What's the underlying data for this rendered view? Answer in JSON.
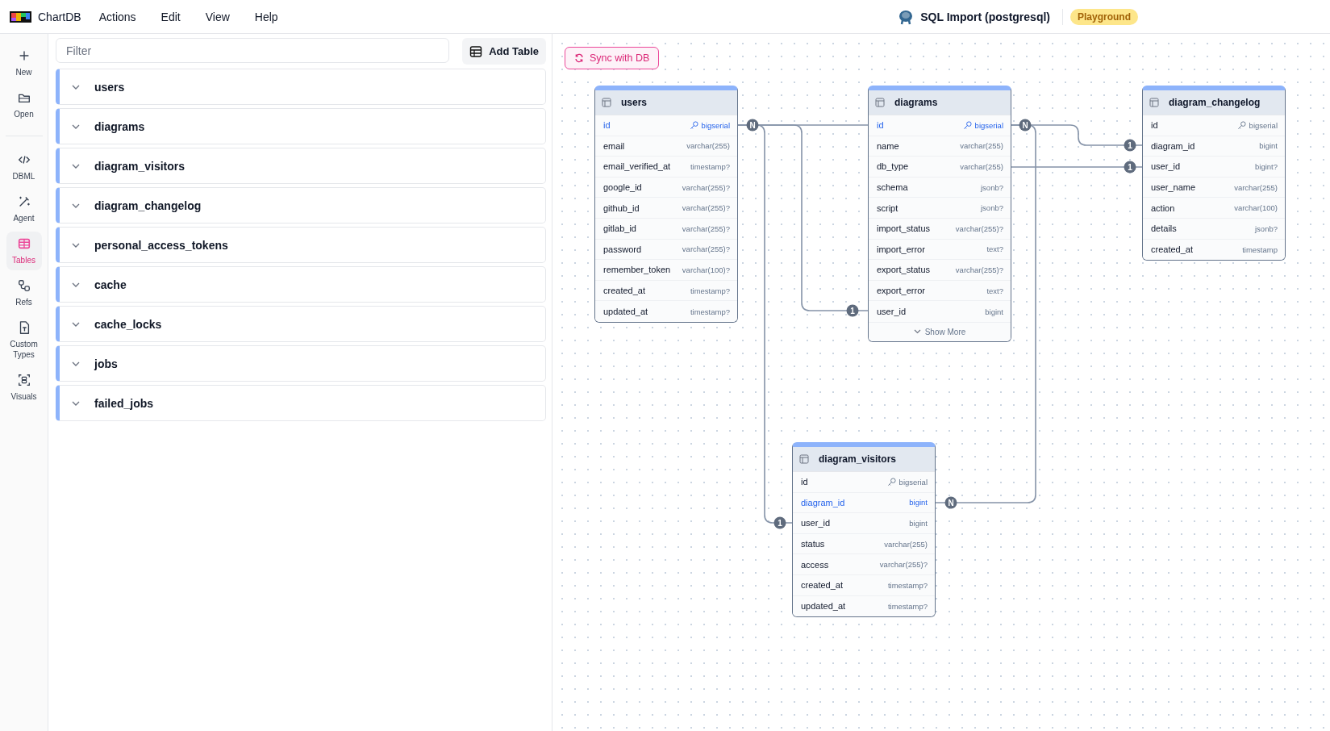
{
  "header": {
    "app_name": "ChartDB",
    "menus": [
      "Actions",
      "Edit",
      "View",
      "Help"
    ],
    "diagram_title": "SQL Import (postgresql)",
    "badge": "Playground"
  },
  "rail": {
    "items": [
      {
        "kind": "new",
        "label": "New",
        "selected": false
      },
      {
        "kind": "open",
        "label": "Open",
        "selected": false
      },
      {
        "kind": "dbml",
        "label": "DBML",
        "selected": false
      },
      {
        "kind": "agent",
        "label": "Agent",
        "selected": false
      },
      {
        "kind": "tables",
        "label": "Tables",
        "selected": true
      },
      {
        "kind": "refs",
        "label": "Refs",
        "selected": false
      },
      {
        "kind": "types",
        "label": "Custom Types",
        "selected": false
      },
      {
        "kind": "visuals",
        "label": "Visuals",
        "selected": false
      }
    ]
  },
  "table_list": {
    "filter": {
      "placeholder": "Filter"
    },
    "add_button": "Add Table",
    "items": [
      {
        "name": "users",
        "expanded": false
      },
      {
        "name": "diagrams",
        "expanded": false
      },
      {
        "name": "diagram_visitors",
        "expanded": false
      },
      {
        "name": "diagram_changelog",
        "expanded": false
      },
      {
        "name": "personal_access_tokens",
        "expanded": false
      },
      {
        "name": "cache",
        "expanded": false
      },
      {
        "name": "cache_locks",
        "expanded": false
      },
      {
        "name": "jobs",
        "expanded": false
      },
      {
        "name": "failed_jobs",
        "expanded": false
      }
    ]
  },
  "canvas": {
    "sync_button": "Sync with DB",
    "tables": [
      {
        "name": "users",
        "fields": [
          {
            "name": "id",
            "type": "bigserial",
            "primary_key": true,
            "highlighted": true
          },
          {
            "name": "email",
            "type": "varchar(255)",
            "primary_key": false,
            "highlighted": false
          },
          {
            "name": "email_verified_at",
            "type": "timestamp?",
            "primary_key": false,
            "highlighted": false
          },
          {
            "name": "google_id",
            "type": "varchar(255)?",
            "primary_key": false,
            "highlighted": false
          },
          {
            "name": "github_id",
            "type": "varchar(255)?",
            "primary_key": false,
            "highlighted": false
          },
          {
            "name": "gitlab_id",
            "type": "varchar(255)?",
            "primary_key": false,
            "highlighted": false
          },
          {
            "name": "password",
            "type": "varchar(255)?",
            "primary_key": false,
            "highlighted": false
          },
          {
            "name": "remember_token",
            "type": "varchar(100)?",
            "primary_key": false,
            "highlighted": false
          },
          {
            "name": "created_at",
            "type": "timestamp?",
            "primary_key": false,
            "highlighted": false
          },
          {
            "name": "updated_at",
            "type": "timestamp?",
            "primary_key": false,
            "highlighted": false
          }
        ]
      },
      {
        "name": "diagrams",
        "show_more": "Show More",
        "fields": [
          {
            "name": "id",
            "type": "bigserial",
            "primary_key": true,
            "highlighted": true
          },
          {
            "name": "name",
            "type": "varchar(255)",
            "primary_key": false,
            "highlighted": false
          },
          {
            "name": "db_type",
            "type": "varchar(255)",
            "primary_key": false,
            "highlighted": false
          },
          {
            "name": "schema",
            "type": "jsonb?",
            "primary_key": false,
            "highlighted": false
          },
          {
            "name": "script",
            "type": "jsonb?",
            "primary_key": false,
            "highlighted": false
          },
          {
            "name": "import_status",
            "type": "varchar(255)?",
            "primary_key": false,
            "highlighted": false
          },
          {
            "name": "import_error",
            "type": "text?",
            "primary_key": false,
            "highlighted": false
          },
          {
            "name": "export_status",
            "type": "varchar(255)?",
            "primary_key": false,
            "highlighted": false
          },
          {
            "name": "export_error",
            "type": "text?",
            "primary_key": false,
            "highlighted": false
          },
          {
            "name": "user_id",
            "type": "bigint",
            "primary_key": false,
            "highlighted": false
          }
        ]
      },
      {
        "name": "diagram_changelog",
        "fields": [
          {
            "name": "id",
            "type": "bigserial",
            "primary_key": true,
            "highlighted": false
          },
          {
            "name": "diagram_id",
            "type": "bigint",
            "primary_key": false,
            "highlighted": false
          },
          {
            "name": "user_id",
            "type": "bigint?",
            "primary_key": false,
            "highlighted": false
          },
          {
            "name": "user_name",
            "type": "varchar(255)",
            "primary_key": false,
            "highlighted": false
          },
          {
            "name": "action",
            "type": "varchar(100)",
            "primary_key": false,
            "highlighted": false
          },
          {
            "name": "details",
            "type": "jsonb?",
            "primary_key": false,
            "highlighted": false
          },
          {
            "name": "created_at",
            "type": "timestamp",
            "primary_key": false,
            "highlighted": false
          }
        ]
      },
      {
        "name": "diagram_visitors",
        "fields": [
          {
            "name": "id",
            "type": "bigserial",
            "primary_key": true,
            "highlighted": false
          },
          {
            "name": "diagram_id",
            "type": "bigint",
            "primary_key": false,
            "highlighted": true
          },
          {
            "name": "user_id",
            "type": "bigint",
            "primary_key": false,
            "highlighted": false
          },
          {
            "name": "status",
            "type": "varchar(255)",
            "primary_key": false,
            "highlighted": false
          },
          {
            "name": "access",
            "type": "varchar(255)?",
            "primary_key": false,
            "highlighted": false
          },
          {
            "name": "created_at",
            "type": "timestamp?",
            "primary_key": false,
            "highlighted": false
          },
          {
            "name": "updated_at",
            "type": "timestamp?",
            "primary_key": false,
            "highlighted": false
          }
        ]
      }
    ],
    "relationships": [
      {
        "source_badge": "N",
        "target_badge": "1"
      },
      {
        "target_badge": "1"
      },
      {
        "target_badge": "1"
      },
      {
        "source_badge": "N",
        "target_badge": "1"
      },
      {
        "target_badge": "N"
      }
    ]
  }
}
